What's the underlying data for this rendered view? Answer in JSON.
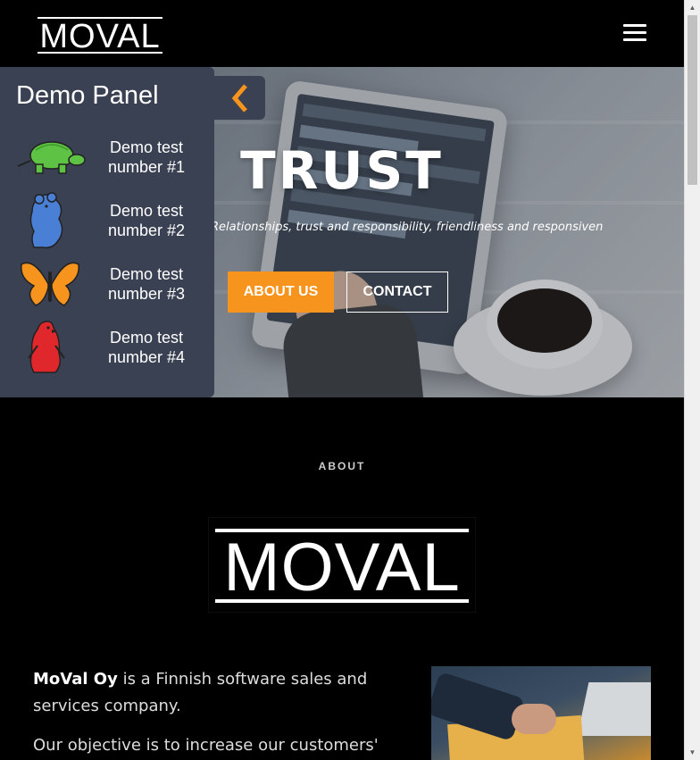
{
  "header": {
    "logo_text": "MOVAL",
    "menu_icon": "hamburger-menu-icon"
  },
  "hero": {
    "title": "TRUST",
    "subtitle": "Relationships, trust and responsibility, friendliness and responsiveness",
    "about_button": "ABOUT US",
    "contact_button": "CONTACT"
  },
  "demo_panel": {
    "title": "Demo Panel",
    "toggle_icon": "chevron-left-icon",
    "items": [
      {
        "label": "Demo test number #1",
        "icon": "turtle-icon",
        "color": "#5ec245"
      },
      {
        "label": "Demo test number #2",
        "icon": "bear-icon",
        "color": "#4a7fd6"
      },
      {
        "label": "Demo test number #3",
        "icon": "butterfly-icon",
        "color": "#f7941d"
      },
      {
        "label": "Demo test number #4",
        "icon": "penguin-icon",
        "color": "#e0282c"
      }
    ]
  },
  "about": {
    "heading": "ABOUT",
    "logo_text": "MOVAL",
    "company_name": "MoVal Oy",
    "paragraph1_rest": " is a Finnish software sales and services company.",
    "paragraph2": "Our objective is to increase our customers'"
  },
  "colors": {
    "accent": "#f7941d",
    "panel_bg": "#3a4152",
    "background": "#000000"
  }
}
